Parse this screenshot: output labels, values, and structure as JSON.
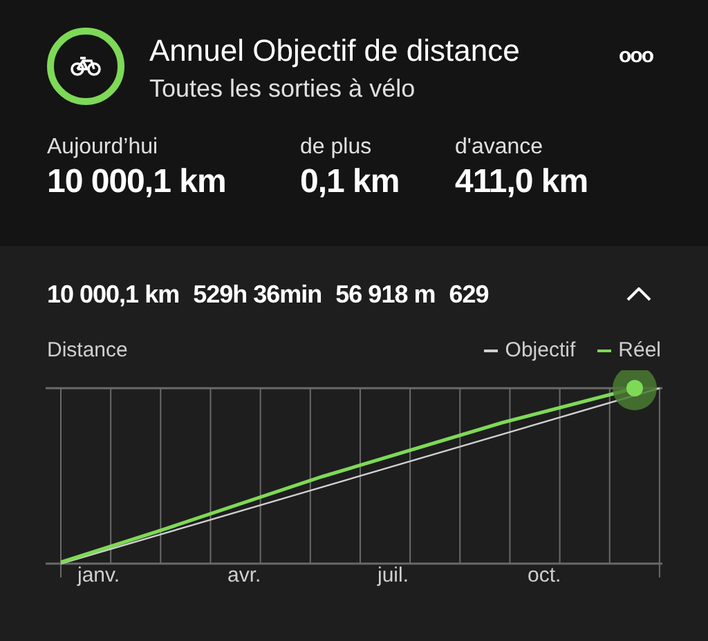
{
  "header": {
    "title": "Annuel Objectif de distance",
    "subtitle": "Toutes les sorties à vélo",
    "menu": "ooo"
  },
  "stats": [
    {
      "label": "Aujourd’hui",
      "value": "10 000,1 km"
    },
    {
      "label": "de plus",
      "value": "0,1 km"
    },
    {
      "label": "d'avance",
      "value": "411,0 km"
    }
  ],
  "summary": [
    "10 000,1 km",
    "529h 36min",
    "56 918 m",
    "629"
  ],
  "expanded": true,
  "chart": {
    "title": "Distance",
    "legend": [
      {
        "label": "Objectif",
        "color": "#d0d0d0"
      },
      {
        "label": "Réel",
        "color": "#7ed957"
      }
    ],
    "months": [
      "janv.",
      "avr.",
      "juil.",
      "oct."
    ]
  }
}
